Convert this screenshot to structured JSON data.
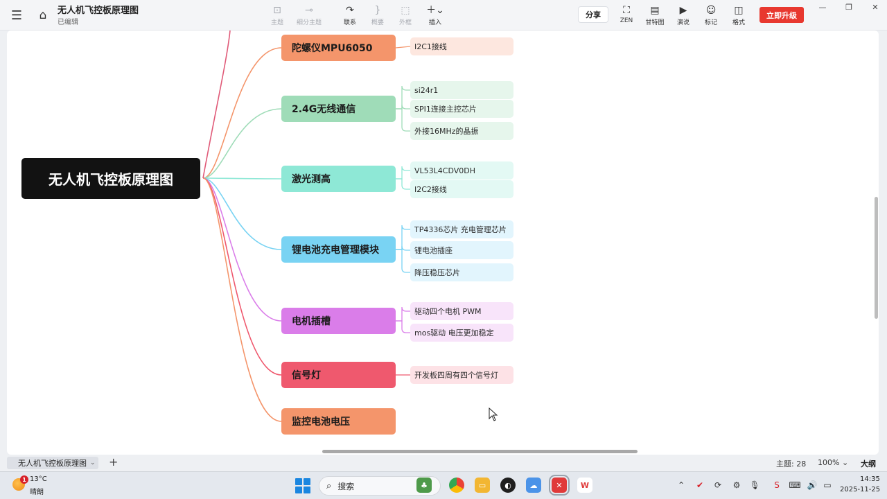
{
  "header": {
    "title": "无人机飞控板原理图",
    "status": "已编辑"
  },
  "toolbar": {
    "tools": [
      {
        "label": "主题",
        "icon": "topic-icon",
        "enabled": false
      },
      {
        "label": "细分主题",
        "icon": "subtopic-icon",
        "enabled": false
      },
      {
        "label": "联系",
        "icon": "relationship-icon",
        "enabled": true
      },
      {
        "label": "概要",
        "icon": "summary-icon",
        "enabled": false
      },
      {
        "label": "外框",
        "icon": "boundary-icon",
        "enabled": false
      },
      {
        "label": "插入",
        "icon": "insert-icon",
        "enabled": true
      }
    ],
    "share": "分享",
    "right_tools": [
      {
        "label": "ZEN",
        "icon": "zen-icon"
      },
      {
        "label": "甘特图",
        "icon": "gantt-icon"
      },
      {
        "label": "演说",
        "icon": "present-icon"
      },
      {
        "label": "标记",
        "icon": "marker-icon"
      },
      {
        "label": "格式",
        "icon": "format-icon"
      }
    ],
    "upgrade": "立即升级"
  },
  "mindmap": {
    "root": "无人机飞控板原理图",
    "branches": [
      {
        "label": "陀螺仪MPU6050",
        "color": "#f4956b",
        "leaf_bg": "#fde7df",
        "children": [
          "I2C1接线"
        ]
      },
      {
        "label": "2.4G无线通信",
        "color": "#9fdcb8",
        "leaf_bg": "#e6f6ec",
        "children": [
          "si24r1",
          "SPI1连接主控芯片",
          "外接16MHz的晶振"
        ]
      },
      {
        "label": "激光测高",
        "color": "#8ee8d6",
        "leaf_bg": "#e3f9f4",
        "children": [
          "VL53L4CDV0DH",
          "I2C2接线"
        ]
      },
      {
        "label": "锂电池充电管理模块",
        "color": "#79d3f3",
        "leaf_bg": "#e2f5fd",
        "children": [
          "TP4336芯片  充电管理芯片",
          "锂电池插座",
          "降压稳压芯片"
        ]
      },
      {
        "label": "电机插槽",
        "color": "#da7de9",
        "leaf_bg": "#f8e4fa",
        "children": [
          "驱动四个电机  PWM",
          "mos驱动 电压更加稳定"
        ]
      },
      {
        "label": "信号灯",
        "color": "#ef596e",
        "leaf_bg": "#fde2e6",
        "children": [
          "开发板四周有四个信号灯"
        ]
      },
      {
        "label": "监控电池电压",
        "color": "#f4956b",
        "leaf_bg": "#fde7df",
        "children": []
      }
    ]
  },
  "statusbar": {
    "sheet_tab": "无人机飞控板原理图",
    "topic_count": "主题: 28",
    "zoom": "100%",
    "outline": "大纲"
  },
  "taskbar": {
    "weather_badge": "1",
    "temperature": "13°C",
    "weather": "晴朗",
    "search_placeholder": "搜索",
    "time": "14:35",
    "date": "2025-11-25"
  }
}
